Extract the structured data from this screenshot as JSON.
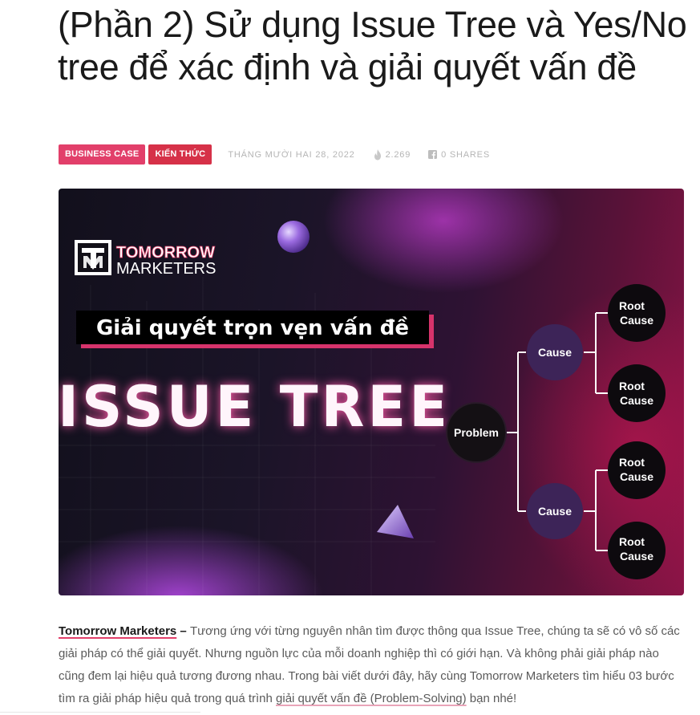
{
  "article": {
    "title": "(Phần 2) Sử dụng Issue Tree và Yes/No tree để xác định và giải quyết vấn đề",
    "categories": [
      "BUSINESS CASE",
      "KIẾN THỨC"
    ],
    "date": "THÁNG MƯỜI HAI 28, 2022",
    "views": "2.269",
    "shares": "0 SHARES"
  },
  "hero": {
    "logo_line1": "TOMORROW",
    "logo_line2": "MARKETERS",
    "subtitle": "Giải quyết trọn vẹn vấn đề",
    "headline": "ISSUE TREE",
    "tree": {
      "root": "Problem",
      "causes": [
        "Cause",
        "Cause"
      ],
      "root_cause_line1": "Root",
      "root_cause_line2": "Cause"
    }
  },
  "intro": {
    "brand": "Tomorrow Marketers",
    "dash": " – ",
    "text_part1": "Tương ứng với từng nguyên nhân tìm được thông qua Issue Tree, chúng ta sẽ có vô số các giải pháp có thể giải quyết. Nhưng nguồn lực của mỗi doanh nghiệp thì có giới hạn. Và không phải giải pháp nào cũng đem lại hiệu quả tương đương nhau. Trong bài viết dưới đây, hãy cùng Tomorrow Marketers tìm hiểu 03 bước tìm ra giải pháp hiệu quả trong quá trình ",
    "link_text": "giải quyết vấn đề (Problem-Solving)",
    "text_part2": " bạn nhé!"
  },
  "colors": {
    "accent": "#e23f6a",
    "badge_secondary": "#d63148",
    "meta_text": "#b5b5b5"
  },
  "icons": [
    "flame-icon",
    "facebook-icon"
  ]
}
